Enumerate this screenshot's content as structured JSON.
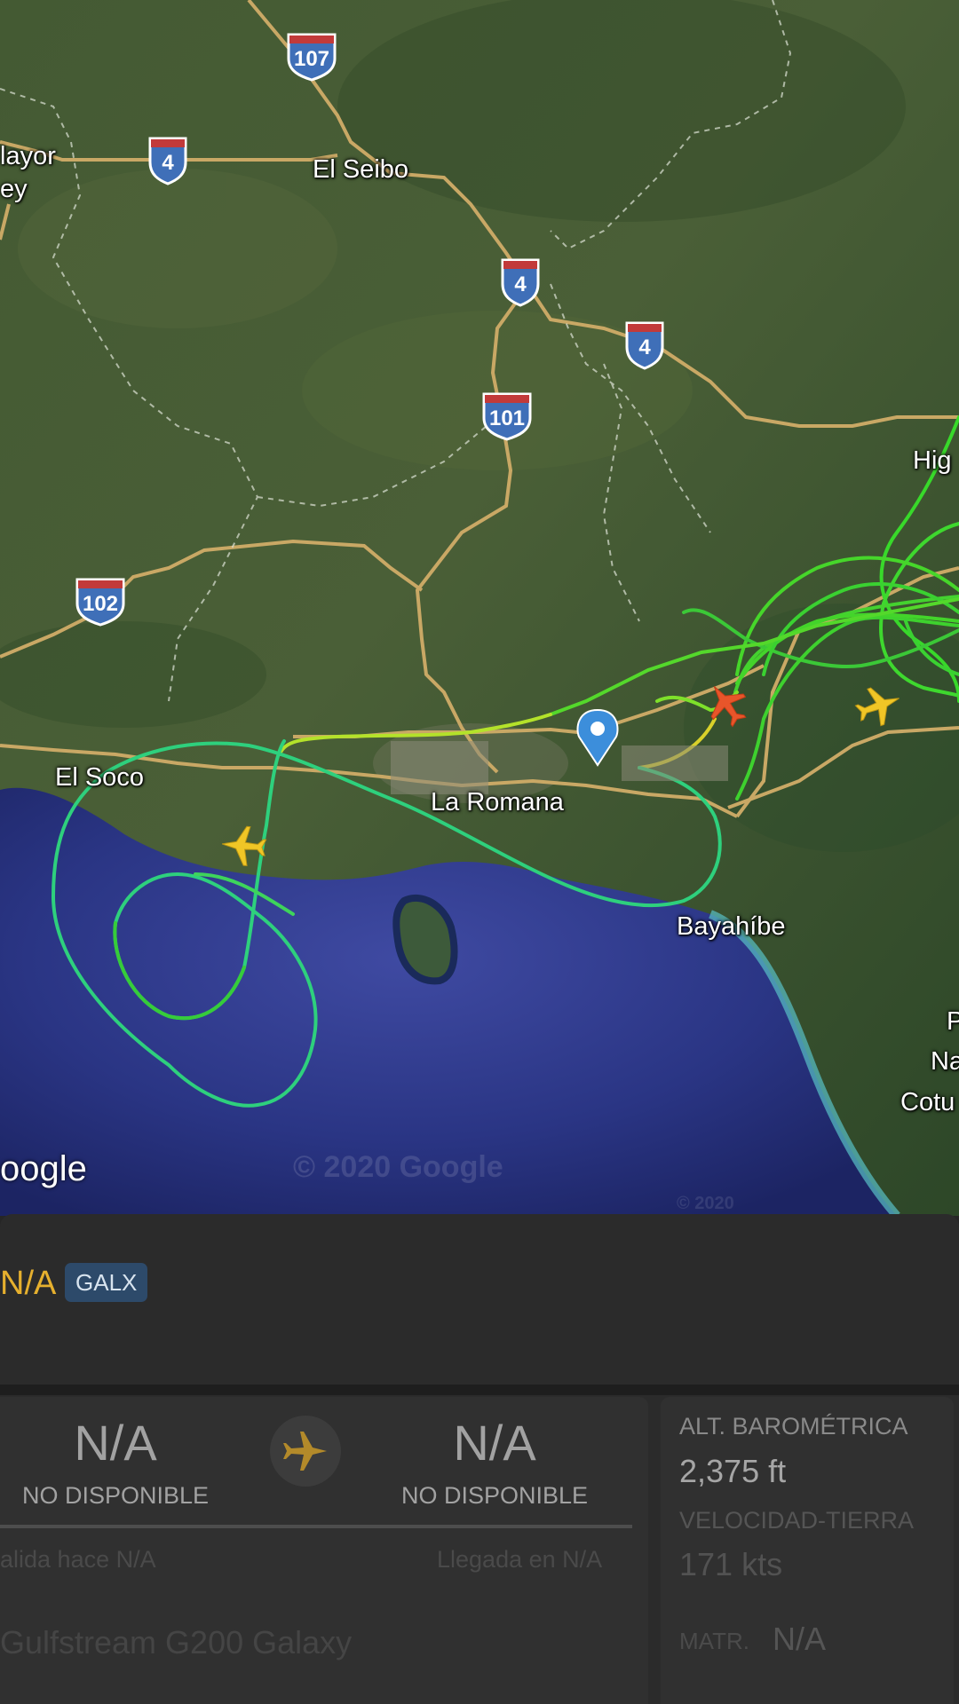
{
  "map": {
    "places": {
      "mayor": "layor",
      "rey": "ey",
      "el_seibo": "El Seibo",
      "higuey": "Hig",
      "el_soco": "El Soco",
      "la_romana": "La Romana",
      "bayahibe": "Bayahíbe",
      "p": "P",
      "na": "Na",
      "cotu": "Cotu"
    },
    "highways": {
      "h107": "107",
      "h4a": "4",
      "h4b": "4",
      "h4c": "4",
      "h101": "101",
      "h102": "102"
    },
    "google_logo": "oogle",
    "copyright": "© 2020 Google",
    "copyright2": "© 2020"
  },
  "flight": {
    "callsign": "N/A",
    "type_code": "GALX",
    "origin_code": "N/A",
    "origin_status": "NO DISPONIBLE",
    "destination_code": "N/A",
    "destination_status": "NO DISPONIBLE",
    "departure_time": "alida hace N/A",
    "arrival_time": "Llegada en N/A",
    "aircraft": "Gulfstream G200 Galaxy"
  },
  "stats": {
    "altitude_label": "ALT. BAROMÉTRICA",
    "altitude_value": "2,375 ft",
    "speed_label": "VELOCIDAD-TIERRA",
    "speed_value": "171 kts",
    "registration_label": "MATR.",
    "registration_value": "N/A"
  },
  "colors": {
    "accent": "#e6b02e",
    "badge": "#2d4a6a",
    "panel": "#2b2b2b"
  }
}
